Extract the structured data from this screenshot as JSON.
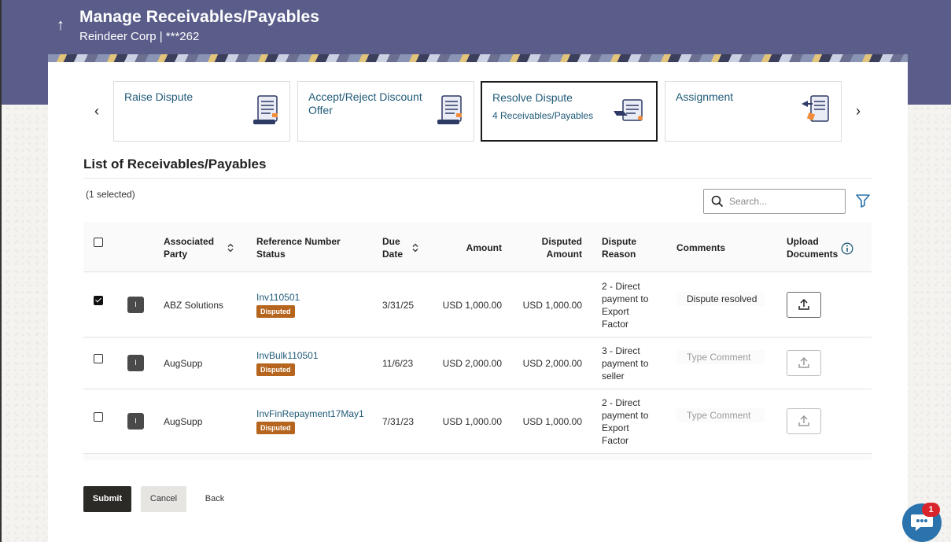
{
  "header": {
    "title": "Manage Receivables/Payables",
    "subtitle": "Reindeer Corp | ***262"
  },
  "cards": [
    {
      "title": "Raise Dispute",
      "sub": "",
      "icon": "document-list-icon"
    },
    {
      "title": "Accept/Reject Discount Offer",
      "sub": "",
      "icon": "document-list-icon"
    },
    {
      "title": "Resolve Dispute",
      "sub": "4 Receivables/Payables",
      "icon": "document-hand-icon",
      "active": true
    },
    {
      "title": "Assignment",
      "sub": "",
      "icon": "document-transfer-icon"
    }
  ],
  "list": {
    "title": "List of Receivables/Payables",
    "selected": "(1 selected)",
    "search_placeholder": "Search..."
  },
  "columns": {
    "party": "Associated Party",
    "ref": "Reference Number Status",
    "due": "Due Date",
    "amount": "Amount",
    "disputed": "Disputed Amount",
    "reason": "Dispute Reason",
    "comments": "Comments",
    "upload": "Upload Documents"
  },
  "rows": [
    {
      "checked": true,
      "avatar": "I",
      "party": "ABZ Solutions",
      "ref": "Inv110501",
      "status": "Disputed",
      "due": "3/31/25",
      "amount": "USD 1,000.00",
      "disputed": "USD 1,000.00",
      "reason": "2 - Direct payment to Export Factor",
      "comment": "Dispute resolved",
      "comment_placeholder": "Type Comment"
    },
    {
      "checked": false,
      "avatar": "I",
      "party": "AugSupp",
      "ref": "InvBulk110501",
      "status": "Disputed",
      "due": "11/6/23",
      "amount": "USD 2,000.00",
      "disputed": "USD 2,000.00",
      "reason": "3 - Direct payment to seller",
      "comment": "",
      "comment_placeholder": "Type Comment"
    },
    {
      "checked": false,
      "avatar": "I",
      "party": "AugSupp",
      "ref": "InvFinRepayment17May1",
      "status": "Disputed",
      "due": "7/31/23",
      "amount": "USD 1,000.00",
      "disputed": "USD 1,000.00",
      "reason": "2 - Direct payment to Export Factor",
      "comment": "",
      "comment_placeholder": "Type Comment"
    }
  ],
  "buttons": {
    "submit": "Submit",
    "cancel": "Cancel",
    "back": "Back"
  },
  "chat": {
    "badge": "1"
  },
  "colors": {
    "header_bg": "#5a5d8a",
    "link": "#1f5a78",
    "badge": "#b5651d",
    "chat": "#2b73ad"
  }
}
